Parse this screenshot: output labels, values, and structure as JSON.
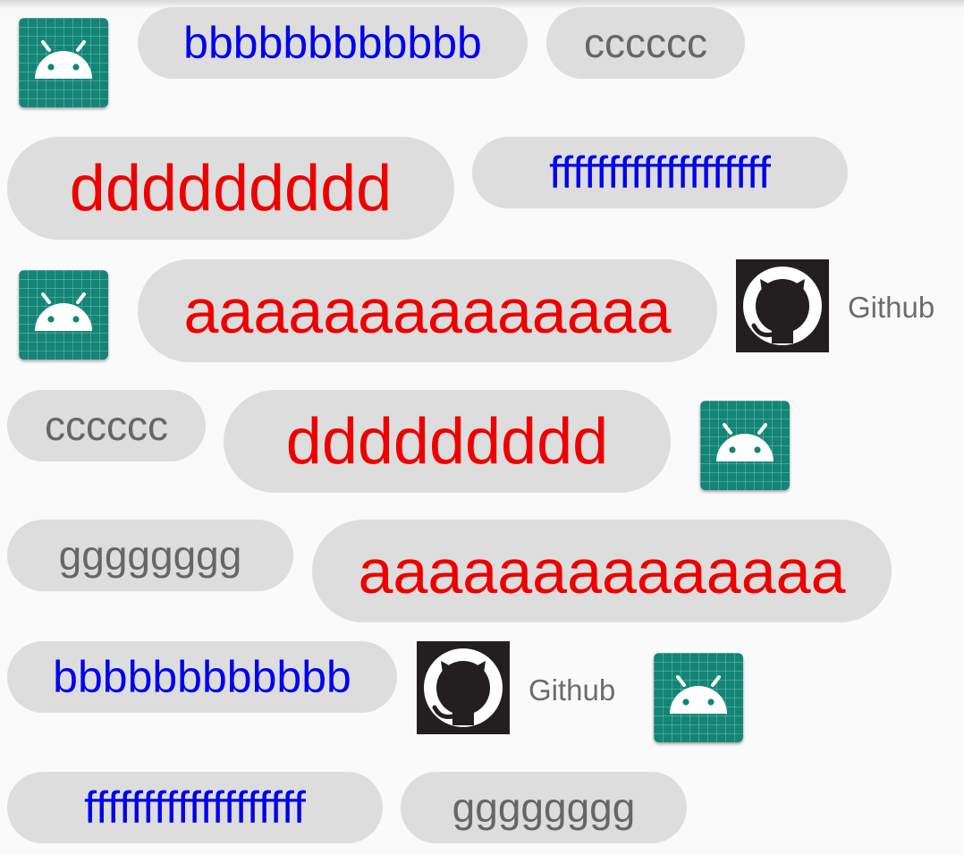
{
  "labels": [
    {
      "id": "c1",
      "text": "bbbbbbbbbbbb",
      "color": "#0000ee"
    },
    {
      "id": "c2",
      "text": "cccccc",
      "color": "#666666"
    },
    {
      "id": "c3",
      "text": "ddddddddd",
      "color": "#ee0000"
    },
    {
      "id": "c4",
      "text": "fffffffffffffffffff",
      "color": "#0000ee"
    },
    {
      "id": "c5",
      "text": "aaaaaaaaaaaaaa",
      "color": "#ee0000"
    },
    {
      "id": "c6",
      "text": "cccccc",
      "color": "#666666"
    },
    {
      "id": "c7",
      "text": "ddddddddd",
      "color": "#ee0000"
    },
    {
      "id": "c8",
      "text": "gggggggg",
      "color": "#666666"
    },
    {
      "id": "c9",
      "text": "aaaaaaaaaaaaaa",
      "color": "#ee0000"
    },
    {
      "id": "c10",
      "text": "bbbbbbbbbbbb",
      "color": "#0000ee"
    },
    {
      "id": "c11",
      "text": "fffffffffffffffffff",
      "color": "#0000ee"
    },
    {
      "id": "c12",
      "text": "gggggggg",
      "color": "#666666"
    }
  ],
  "github_items": [
    {
      "id": "g1",
      "label": "Github"
    },
    {
      "id": "g2",
      "label": "Github"
    }
  ],
  "icons": {
    "android": "android-app-icon",
    "github": "github-octocat-icon"
  },
  "colors": {
    "chip_background": "#dddddd",
    "android_tile": "#138577",
    "github_tile": "#231f20",
    "page_background": "#fafafa"
  }
}
